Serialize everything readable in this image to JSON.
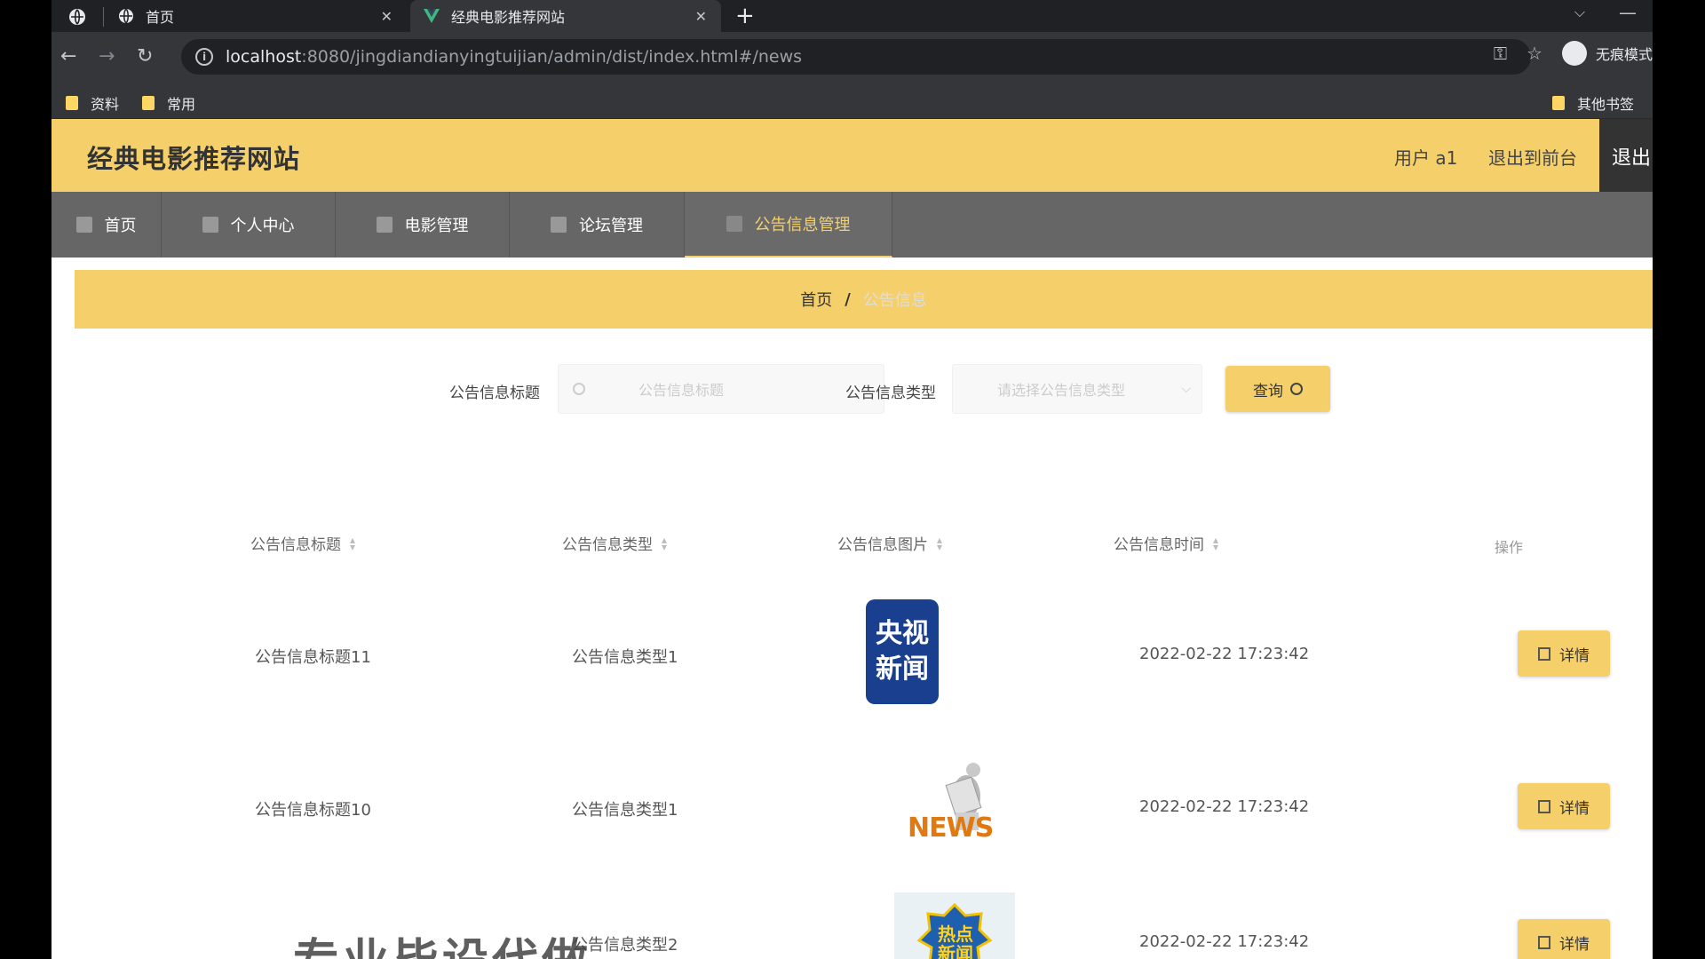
{
  "browser": {
    "tabs": [
      {
        "label": "首页",
        "active": false
      },
      {
        "label": "经典电影推荐网站",
        "active": true
      }
    ],
    "url_host": "localhost",
    "url_rest": ":8080/jingdiandianyingtuijian/admin/dist/index.html#/news",
    "incognito_label": "无痕模式",
    "bookmarks": [
      "资料",
      "常用"
    ],
    "other_bookmarks": "其他书签"
  },
  "header": {
    "title": "经典电影推荐网站",
    "user": "用户 a1",
    "back_front": "退出到前台",
    "logout": "退出"
  },
  "menu": [
    {
      "label": "首页",
      "active": false
    },
    {
      "label": "个人中心",
      "active": false
    },
    {
      "label": "电影管理",
      "active": false
    },
    {
      "label": "论坛管理",
      "active": false
    },
    {
      "label": "公告信息管理",
      "active": true
    }
  ],
  "breadcrumb": {
    "home": "首页",
    "sep": "/",
    "current": "公告信息"
  },
  "search": {
    "title_label": "公告信息标题",
    "title_placeholder": "公告信息标题",
    "type_label": "公告信息类型",
    "type_placeholder": "请选择公告信息类型",
    "query_button": "查询"
  },
  "table": {
    "headers": [
      "公告信息标题",
      "公告信息类型",
      "公告信息图片",
      "公告信息时间",
      "操作"
    ],
    "rows": [
      {
        "title": "公告信息标题11",
        "type": "公告信息类型1",
        "image": "cctv-news",
        "image_text": [
          "央视",
          "新闻"
        ],
        "time": "2022-02-22 17:23:42",
        "action": "详情"
      },
      {
        "title": "公告信息标题10",
        "type": "公告信息类型1",
        "image": "news-reader",
        "image_text": [
          "NEWS"
        ],
        "time": "2022-02-22 17:23:42",
        "action": "详情"
      },
      {
        "title": "",
        "type": "公告信息类型2",
        "image": "hot-news",
        "image_text": [
          "热点",
          "新闻"
        ],
        "time": "2022-02-22 17:23:42",
        "action": "详情"
      }
    ]
  },
  "watermark": "专业毕设代做",
  "colors": {
    "accent": "#f5d06a",
    "menu_bg": "#666666",
    "chrome_dark": "#202124"
  }
}
